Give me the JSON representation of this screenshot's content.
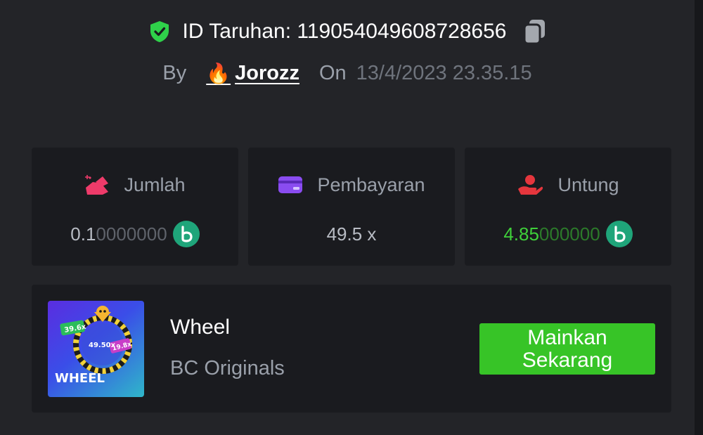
{
  "bet": {
    "id_label": "ID Taruhan:",
    "id_value": "119054049608728656",
    "by_label": "By",
    "user_emoji": "🔥",
    "username": "Jorozz",
    "on_label": "On",
    "datetime": "13/4/2023 23.35.15"
  },
  "stats": {
    "amount": {
      "label": "Jumlah",
      "value_strong": "0.1",
      "value_dim": "0000000"
    },
    "payout": {
      "label": "Pembayaran",
      "value": "49.5 x"
    },
    "profit": {
      "label": "Untung",
      "value_strong": "4.85",
      "value_dim": "000000"
    }
  },
  "game": {
    "thumb_word": "WHEEL",
    "thumb_labels": [
      "39.6x",
      "49.50x",
      "19.8x"
    ],
    "name": "Wheel",
    "provider": "BC Originals",
    "play_label": "Mainkan Sekarang"
  },
  "colors": {
    "background": "#232428",
    "card": "#1a1b1f",
    "accent_green": "#37c427",
    "profit_green": "#3fd03a",
    "amount_icon": "#ee3b6a",
    "payout_icon": "#8a4cf0",
    "profit_icon": "#e5363d",
    "coin": "#1fa57a"
  },
  "icons": {
    "verified": "shield-check-icon",
    "copy": "copy-icon",
    "amount": "amount-hand-icon",
    "payout": "card-icon",
    "profit": "profit-hand-icon",
    "coin": "bc-coin-icon"
  }
}
